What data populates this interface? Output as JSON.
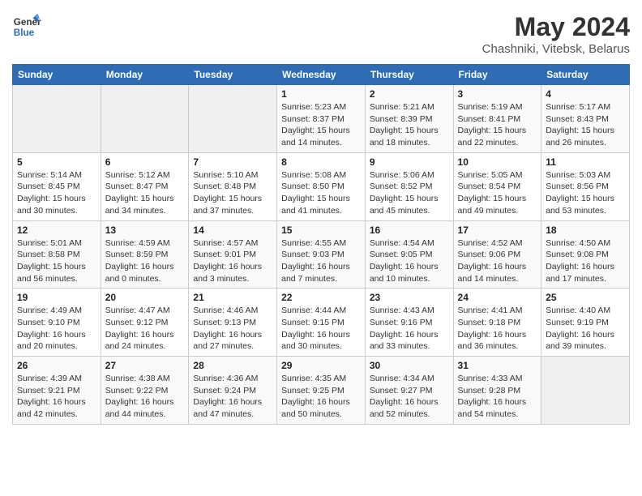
{
  "header": {
    "logo_line1": "General",
    "logo_line2": "Blue",
    "month_year": "May 2024",
    "location": "Chashniki, Vitebsk, Belarus"
  },
  "weekdays": [
    "Sunday",
    "Monday",
    "Tuesday",
    "Wednesday",
    "Thursday",
    "Friday",
    "Saturday"
  ],
  "weeks": [
    [
      {
        "day": "",
        "info": ""
      },
      {
        "day": "",
        "info": ""
      },
      {
        "day": "",
        "info": ""
      },
      {
        "day": "1",
        "info": "Sunrise: 5:23 AM\nSunset: 8:37 PM\nDaylight: 15 hours\nand 14 minutes."
      },
      {
        "day": "2",
        "info": "Sunrise: 5:21 AM\nSunset: 8:39 PM\nDaylight: 15 hours\nand 18 minutes."
      },
      {
        "day": "3",
        "info": "Sunrise: 5:19 AM\nSunset: 8:41 PM\nDaylight: 15 hours\nand 22 minutes."
      },
      {
        "day": "4",
        "info": "Sunrise: 5:17 AM\nSunset: 8:43 PM\nDaylight: 15 hours\nand 26 minutes."
      }
    ],
    [
      {
        "day": "5",
        "info": "Sunrise: 5:14 AM\nSunset: 8:45 PM\nDaylight: 15 hours\nand 30 minutes."
      },
      {
        "day": "6",
        "info": "Sunrise: 5:12 AM\nSunset: 8:47 PM\nDaylight: 15 hours\nand 34 minutes."
      },
      {
        "day": "7",
        "info": "Sunrise: 5:10 AM\nSunset: 8:48 PM\nDaylight: 15 hours\nand 37 minutes."
      },
      {
        "day": "8",
        "info": "Sunrise: 5:08 AM\nSunset: 8:50 PM\nDaylight: 15 hours\nand 41 minutes."
      },
      {
        "day": "9",
        "info": "Sunrise: 5:06 AM\nSunset: 8:52 PM\nDaylight: 15 hours\nand 45 minutes."
      },
      {
        "day": "10",
        "info": "Sunrise: 5:05 AM\nSunset: 8:54 PM\nDaylight: 15 hours\nand 49 minutes."
      },
      {
        "day": "11",
        "info": "Sunrise: 5:03 AM\nSunset: 8:56 PM\nDaylight: 15 hours\nand 53 minutes."
      }
    ],
    [
      {
        "day": "12",
        "info": "Sunrise: 5:01 AM\nSunset: 8:58 PM\nDaylight: 15 hours\nand 56 minutes."
      },
      {
        "day": "13",
        "info": "Sunrise: 4:59 AM\nSunset: 8:59 PM\nDaylight: 16 hours\nand 0 minutes."
      },
      {
        "day": "14",
        "info": "Sunrise: 4:57 AM\nSunset: 9:01 PM\nDaylight: 16 hours\nand 3 minutes."
      },
      {
        "day": "15",
        "info": "Sunrise: 4:55 AM\nSunset: 9:03 PM\nDaylight: 16 hours\nand 7 minutes."
      },
      {
        "day": "16",
        "info": "Sunrise: 4:54 AM\nSunset: 9:05 PM\nDaylight: 16 hours\nand 10 minutes."
      },
      {
        "day": "17",
        "info": "Sunrise: 4:52 AM\nSunset: 9:06 PM\nDaylight: 16 hours\nand 14 minutes."
      },
      {
        "day": "18",
        "info": "Sunrise: 4:50 AM\nSunset: 9:08 PM\nDaylight: 16 hours\nand 17 minutes."
      }
    ],
    [
      {
        "day": "19",
        "info": "Sunrise: 4:49 AM\nSunset: 9:10 PM\nDaylight: 16 hours\nand 20 minutes."
      },
      {
        "day": "20",
        "info": "Sunrise: 4:47 AM\nSunset: 9:12 PM\nDaylight: 16 hours\nand 24 minutes."
      },
      {
        "day": "21",
        "info": "Sunrise: 4:46 AM\nSunset: 9:13 PM\nDaylight: 16 hours\nand 27 minutes."
      },
      {
        "day": "22",
        "info": "Sunrise: 4:44 AM\nSunset: 9:15 PM\nDaylight: 16 hours\nand 30 minutes."
      },
      {
        "day": "23",
        "info": "Sunrise: 4:43 AM\nSunset: 9:16 PM\nDaylight: 16 hours\nand 33 minutes."
      },
      {
        "day": "24",
        "info": "Sunrise: 4:41 AM\nSunset: 9:18 PM\nDaylight: 16 hours\nand 36 minutes."
      },
      {
        "day": "25",
        "info": "Sunrise: 4:40 AM\nSunset: 9:19 PM\nDaylight: 16 hours\nand 39 minutes."
      }
    ],
    [
      {
        "day": "26",
        "info": "Sunrise: 4:39 AM\nSunset: 9:21 PM\nDaylight: 16 hours\nand 42 minutes."
      },
      {
        "day": "27",
        "info": "Sunrise: 4:38 AM\nSunset: 9:22 PM\nDaylight: 16 hours\nand 44 minutes."
      },
      {
        "day": "28",
        "info": "Sunrise: 4:36 AM\nSunset: 9:24 PM\nDaylight: 16 hours\nand 47 minutes."
      },
      {
        "day": "29",
        "info": "Sunrise: 4:35 AM\nSunset: 9:25 PM\nDaylight: 16 hours\nand 50 minutes."
      },
      {
        "day": "30",
        "info": "Sunrise: 4:34 AM\nSunset: 9:27 PM\nDaylight: 16 hours\nand 52 minutes."
      },
      {
        "day": "31",
        "info": "Sunrise: 4:33 AM\nSunset: 9:28 PM\nDaylight: 16 hours\nand 54 minutes."
      },
      {
        "day": "",
        "info": ""
      }
    ]
  ]
}
